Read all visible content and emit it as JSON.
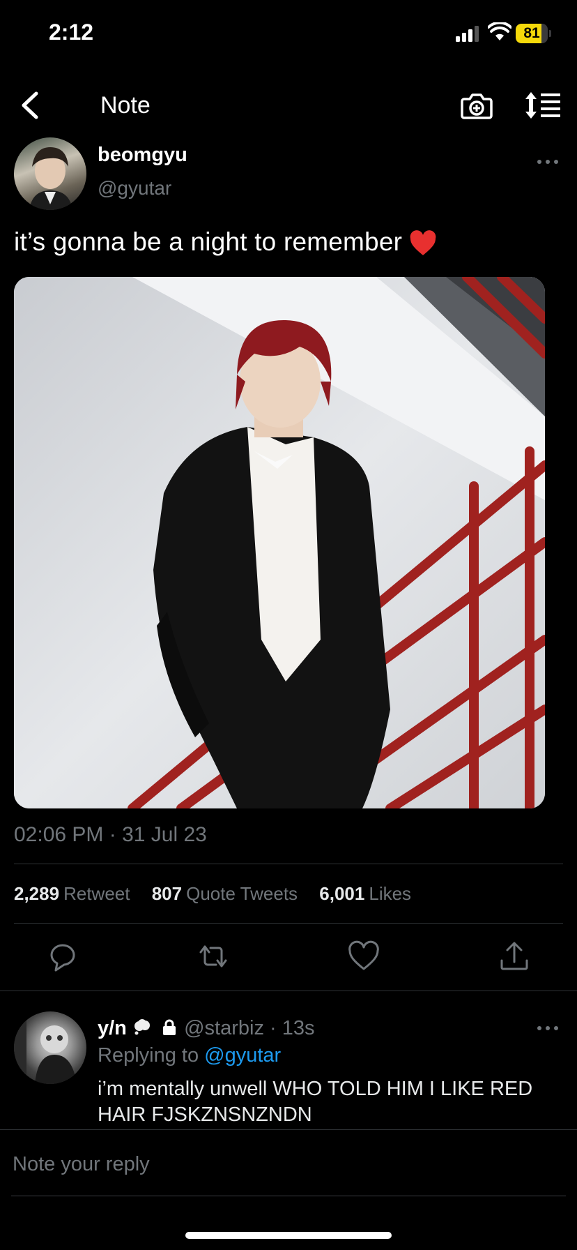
{
  "status_bar": {
    "time": "2:12",
    "battery": "81",
    "battery_level": 0.81
  },
  "nav": {
    "title": "Note",
    "icons": [
      "back-chevron-icon",
      "camera-icon",
      "sort-icon"
    ]
  },
  "tweet": {
    "name": "beomgyu",
    "handle": "@gyutar",
    "text": "it’s gonna be a night to remember",
    "timestamp": "02:06 PM · 31 Jul 23",
    "stats": [
      {
        "count": "2,289",
        "label": "Retweet"
      },
      {
        "count": "807",
        "label": "Quote Tweets"
      },
      {
        "count": "6,001",
        "label": "Likes"
      }
    ],
    "actions": [
      "reply-icon",
      "retweet-icon",
      "like-icon",
      "share-icon"
    ]
  },
  "reply": {
    "name": "y/n",
    "handle": "@starbiz",
    "separator": "·",
    "time": "13s",
    "replying_prefix": "Replying to",
    "replying_to": "@gyutar",
    "text": "i’m mentally unwell WHO TOLD HIM I LIKE RED HAIR FJSKZNSNZNDN"
  },
  "compose": {
    "placeholder": "Note your reply"
  },
  "colors": {
    "background": "#000000",
    "muted": "#71767b",
    "link": "#1d9bf0",
    "battery": "#f5d90a"
  }
}
